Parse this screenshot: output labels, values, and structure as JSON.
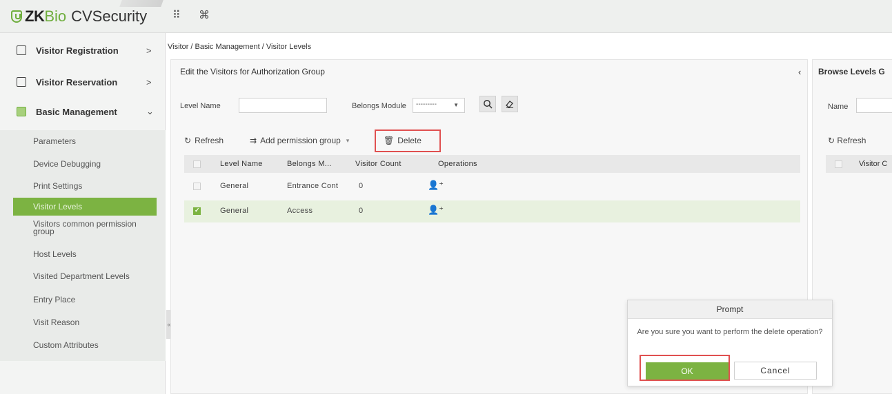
{
  "app": {
    "logo_zk": "ZK",
    "logo_bio": "Bio",
    "logo_rest": "CVSecurity",
    "grid_icon": "⠿",
    "cmd_icon": "⌘"
  },
  "sidebar": {
    "groups": [
      {
        "label": "Visitor Registration",
        "arrow": ">"
      },
      {
        "label": "Visitor Reservation",
        "arrow": ">"
      },
      {
        "label": "Basic Management",
        "arrow": "⌄"
      }
    ],
    "items": [
      {
        "label": "Parameters"
      },
      {
        "label": "Device Debugging"
      },
      {
        "label": "Print Settings"
      },
      {
        "label": "Visitor Levels"
      },
      {
        "label": "Visitors common permission group"
      },
      {
        "label": "Host Levels"
      },
      {
        "label": "Visited Department Levels"
      },
      {
        "label": "Entry Place"
      },
      {
        "label": "Visit Reason"
      },
      {
        "label": "Custom Attributes"
      }
    ],
    "collapse_glyph": "«"
  },
  "breadcrumb": "Visitor / Basic Management / Visitor Levels",
  "main": {
    "title": "Edit the Visitors for Authorization Group",
    "collapse_glyph": "‹",
    "level_name_label": "Level Name",
    "level_name_value": "",
    "belongs_module_label": "Belongs Module",
    "belongs_module_value": "---------",
    "toolbar": {
      "refresh": "Refresh",
      "add_group": "Add permission group",
      "delete": "Delete"
    },
    "columns": [
      "Level Name",
      "Belongs M...",
      "Visitor Count",
      "Operations"
    ],
    "rows": [
      {
        "level_name": "General",
        "module": "Entrance Cont",
        "count": "0",
        "checked": false
      },
      {
        "level_name": "General",
        "module": "Access",
        "count": "0",
        "checked": true
      }
    ]
  },
  "right_panel": {
    "title": "Browse Levels G",
    "name_label": "Name",
    "refresh": "Refresh",
    "column": "Visitor C"
  },
  "dialog": {
    "title": "Prompt",
    "message": "Are you sure you want to perform the delete operation?",
    "ok": "OK",
    "cancel": "Cancel"
  },
  "colors": {
    "accent": "#7cb342",
    "highlight": "#e05050"
  }
}
